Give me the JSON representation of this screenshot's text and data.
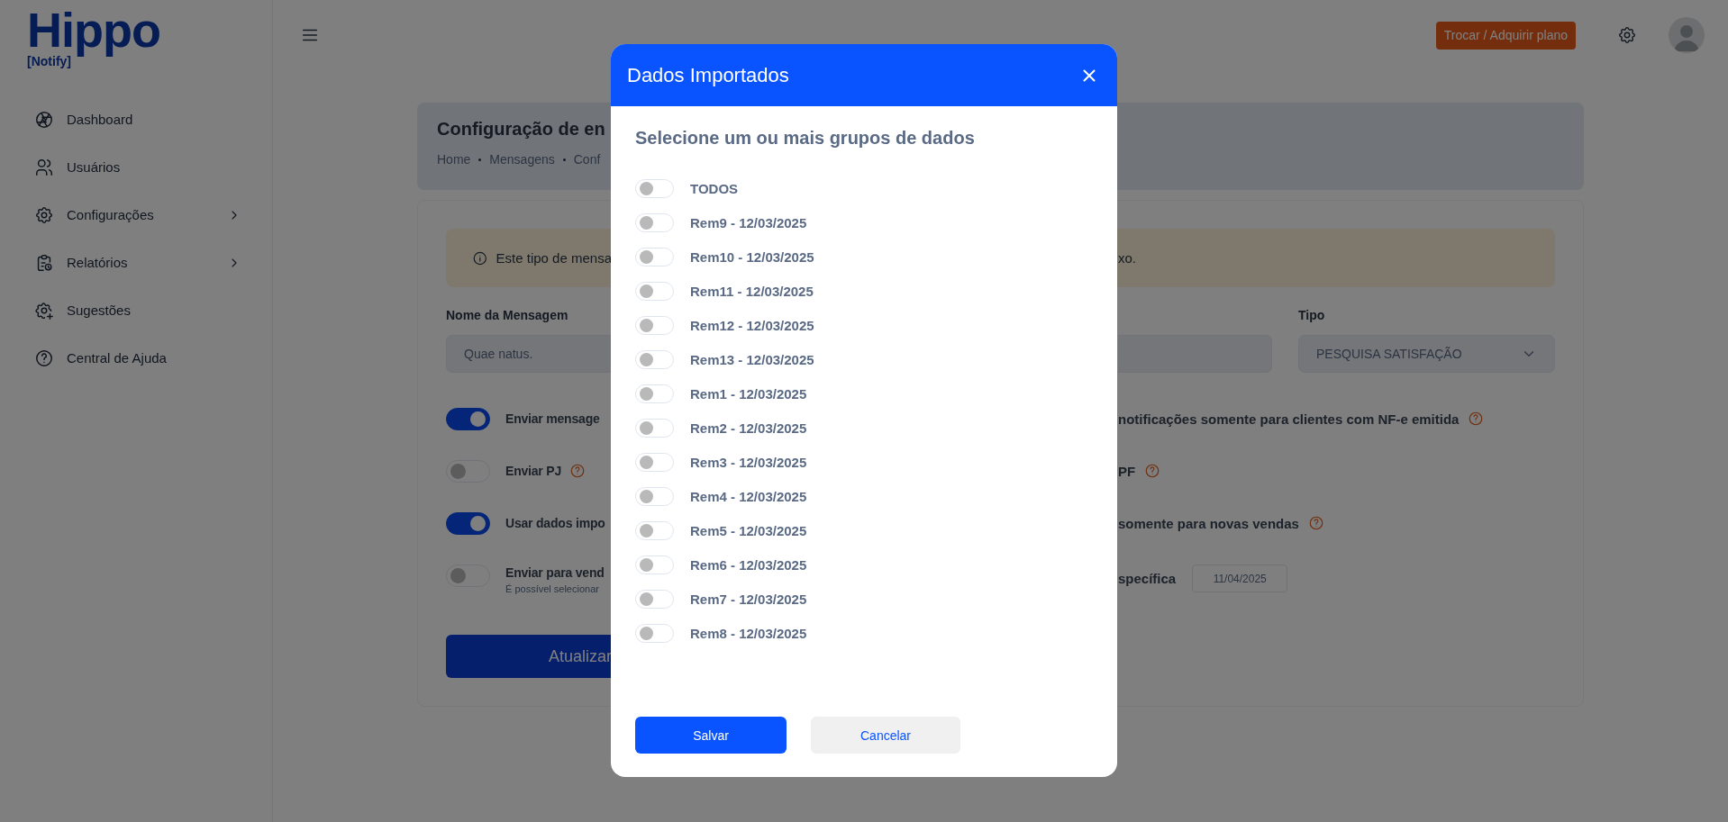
{
  "logo": {
    "wordmark": "Hippo",
    "tagline": "[Notify]"
  },
  "sidebar": {
    "items": [
      {
        "label": "Dashboard",
        "has_submenu": false
      },
      {
        "label": "Usuários",
        "has_submenu": false
      },
      {
        "label": "Configurações",
        "has_submenu": true
      },
      {
        "label": "Relatórios",
        "has_submenu": true
      },
      {
        "label": "Sugestões",
        "has_submenu": false
      },
      {
        "label": "Central de Ajuda",
        "has_submenu": false
      }
    ]
  },
  "topbar": {
    "plan_button": "Trocar / Adquirir plano"
  },
  "page_header": {
    "title": "Configuração de en",
    "breadcrumb": [
      "Home",
      "Mensagens",
      "Conf"
    ]
  },
  "alert": {
    "text_start": "Este tipo de mensa",
    "text_end": "xo."
  },
  "form": {
    "name_label": "Nome da Mensagem",
    "name_value": "Quae natus.",
    "type_label": "Tipo",
    "type_value": "PESQUISA SATISFAÇÃO"
  },
  "toggles_left": [
    {
      "label": "Enviar mensage",
      "on": true,
      "help": false
    },
    {
      "label": "Enviar PJ",
      "on": false,
      "help": true
    },
    {
      "label": "Usar dados impo",
      "on": true,
      "help": false
    },
    {
      "label": "Enviar para vend",
      "on": false,
      "help": false,
      "note": "É possível selecionar"
    }
  ],
  "options_right": [
    {
      "label": "notificações somente para clientes com NF-e emitida",
      "help": true
    },
    {
      "label": "PF",
      "help": true
    },
    {
      "label": "somente para novas vendas",
      "help": true
    },
    {
      "label": "specífica",
      "help": false,
      "date": "11/04/2025"
    }
  ],
  "submit_button": "Atualizar",
  "modal": {
    "title": "Dados Importados",
    "subtitle": "Selecione um ou mais grupos de dados",
    "groups": [
      {
        "label": "TODOS",
        "on": false
      },
      {
        "label": "Rem9 - 12/03/2025",
        "on": false
      },
      {
        "label": "Rem10 - 12/03/2025",
        "on": false
      },
      {
        "label": "Rem11 - 12/03/2025",
        "on": false
      },
      {
        "label": "Rem12 - 12/03/2025",
        "on": false
      },
      {
        "label": "Rem13 - 12/03/2025",
        "on": false
      },
      {
        "label": "Rem1 - 12/03/2025",
        "on": false
      },
      {
        "label": "Rem2 - 12/03/2025",
        "on": false
      },
      {
        "label": "Rem3 - 12/03/2025",
        "on": false
      },
      {
        "label": "Rem4 - 12/03/2025",
        "on": false
      },
      {
        "label": "Rem5 - 12/03/2025",
        "on": false
      },
      {
        "label": "Rem6 - 12/03/2025",
        "on": false
      },
      {
        "label": "Rem7 - 12/03/2025",
        "on": false
      },
      {
        "label": "Rem8 - 12/03/2025",
        "on": false
      }
    ],
    "save_button": "Salvar",
    "cancel_button": "Cancelar"
  }
}
